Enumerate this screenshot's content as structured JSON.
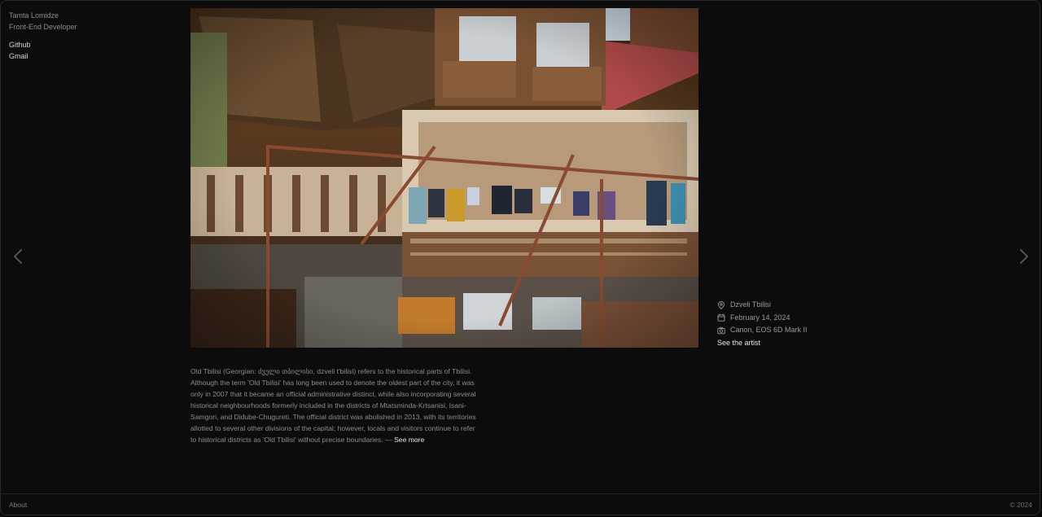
{
  "sidebar": {
    "name": "Tamta Lomidze",
    "role": "Front-End Developer",
    "links": [
      "Github",
      "Gmail"
    ]
  },
  "photo": {
    "alt": "Old Tbilisi wooden balconies with hanging laundry"
  },
  "meta": {
    "location": "Dzveli Tbilisi",
    "date": "February 14, 2024",
    "camera": "Canon, EOS 6D Mark II",
    "artist_link": "See the artist"
  },
  "description": {
    "text": "Old Tbilisi (Georgian: ძველი თბილისი, dzveli t'bilisi) refers to the historical parts of Tbilisi. Although the term 'Old Tbilisi' has long been used to denote the oldest part of the city, it was only in 2007 that it became an official administrative distinct, while also incorporating several historical neighbourhoods formerly included in the districts of Mtatsminda-Krtsanisi, Isani-Samgori, and Didube-Chugureti. The official district was abolished in 2013, with its territories allotted to several other divisions of the capital; however, locals and visitors continue to refer to historical districts as 'Old Tbilisi' without precise boundaries. —",
    "more": "See more"
  },
  "footer": {
    "about": "About",
    "copyright": "© 2024"
  },
  "icons": {
    "prev": "chevron-left-icon",
    "next": "chevron-right-icon",
    "location": "map-pin-icon",
    "date": "calendar-icon",
    "camera": "camera-icon"
  }
}
